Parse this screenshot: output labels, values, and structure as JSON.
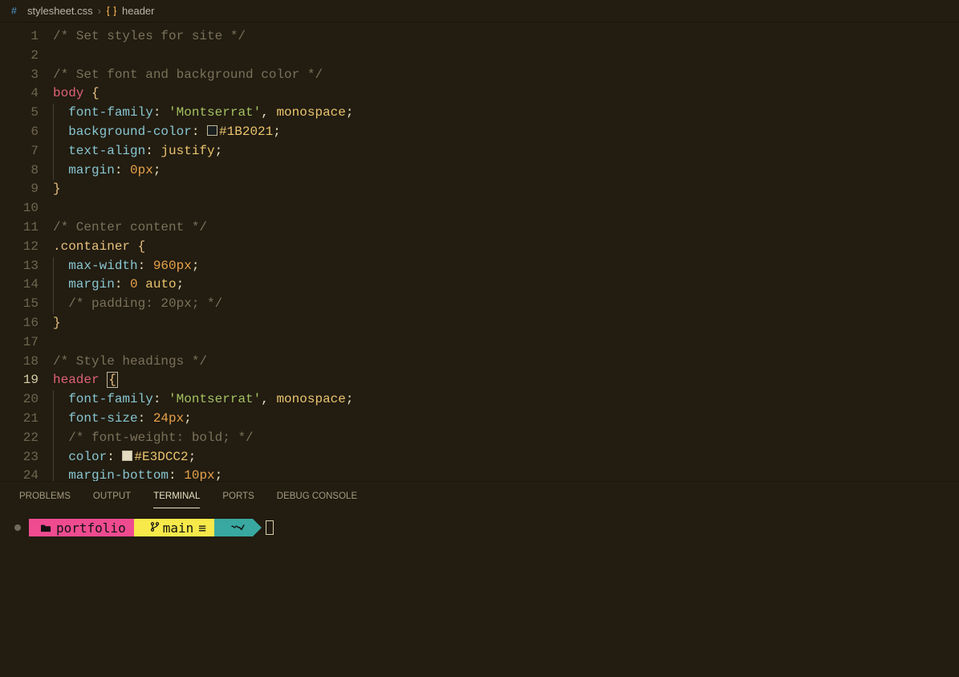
{
  "breadcrumb": {
    "file": "stylesheet.css",
    "symbol": "header"
  },
  "editor": {
    "swatch_colors": {
      "1": "#1B2021",
      "2": "#E3DCC2"
    },
    "lines": [
      {
        "n": 1,
        "tokens": [
          {
            "t": "/* Set styles for site */",
            "c": "cmt"
          }
        ]
      },
      {
        "n": 2,
        "tokens": []
      },
      {
        "n": 3,
        "tokens": [
          {
            "t": "/* Set font and background color */",
            "c": "cmt"
          }
        ]
      },
      {
        "n": 4,
        "tokens": [
          {
            "t": "body",
            "c": "sel"
          },
          {
            "t": " ",
            "c": "punc"
          },
          {
            "t": "{",
            "c": "brace"
          }
        ]
      },
      {
        "n": 5,
        "indent": 1,
        "tokens": [
          {
            "t": "font-family",
            "c": "prop"
          },
          {
            "t": ": ",
            "c": "punc"
          },
          {
            "t": "'Montserrat'",
            "c": "str"
          },
          {
            "t": ", ",
            "c": "punc"
          },
          {
            "t": "monospace",
            "c": "val"
          },
          {
            "t": ";",
            "c": "punc"
          }
        ]
      },
      {
        "n": 6,
        "indent": 1,
        "tokens": [
          {
            "t": "background-color",
            "c": "prop"
          },
          {
            "t": ": ",
            "c": "punc"
          },
          {
            "swatch": "1"
          },
          {
            "t": "#1B2021",
            "c": "val"
          },
          {
            "t": ";",
            "c": "punc"
          }
        ]
      },
      {
        "n": 7,
        "indent": 1,
        "tokens": [
          {
            "t": "text-align",
            "c": "prop"
          },
          {
            "t": ": ",
            "c": "punc"
          },
          {
            "t": "justify",
            "c": "val"
          },
          {
            "t": ";",
            "c": "punc"
          }
        ]
      },
      {
        "n": 8,
        "indent": 1,
        "tokens": [
          {
            "t": "margin",
            "c": "prop"
          },
          {
            "t": ": ",
            "c": "punc"
          },
          {
            "t": "0px",
            "c": "num"
          },
          {
            "t": ";",
            "c": "punc"
          }
        ]
      },
      {
        "n": 9,
        "tokens": [
          {
            "t": "}",
            "c": "brace"
          }
        ]
      },
      {
        "n": 10,
        "tokens": []
      },
      {
        "n": 11,
        "tokens": [
          {
            "t": "/* Center content */",
            "c": "cmt"
          }
        ]
      },
      {
        "n": 12,
        "tokens": [
          {
            "t": ".container",
            "c": "classsel"
          },
          {
            "t": " ",
            "c": "punc"
          },
          {
            "t": "{",
            "c": "brace"
          }
        ]
      },
      {
        "n": 13,
        "indent": 1,
        "tokens": [
          {
            "t": "max-width",
            "c": "prop"
          },
          {
            "t": ": ",
            "c": "punc"
          },
          {
            "t": "960px",
            "c": "num"
          },
          {
            "t": ";",
            "c": "punc"
          }
        ]
      },
      {
        "n": 14,
        "indent": 1,
        "tokens": [
          {
            "t": "margin",
            "c": "prop"
          },
          {
            "t": ": ",
            "c": "punc"
          },
          {
            "t": "0",
            "c": "num"
          },
          {
            "t": " ",
            "c": "punc"
          },
          {
            "t": "auto",
            "c": "val"
          },
          {
            "t": ";",
            "c": "punc"
          }
        ]
      },
      {
        "n": 15,
        "indent": 1,
        "tokens": [
          {
            "t": "/* padding: 20px; */",
            "c": "cmt"
          }
        ]
      },
      {
        "n": 16,
        "tokens": [
          {
            "t": "}",
            "c": "brace"
          }
        ]
      },
      {
        "n": 17,
        "tokens": []
      },
      {
        "n": 18,
        "tokens": [
          {
            "t": "/* Style headings */",
            "c": "cmt"
          }
        ]
      },
      {
        "n": 19,
        "active": true,
        "tokens": [
          {
            "t": "header",
            "c": "sel"
          },
          {
            "t": " ",
            "c": "punc"
          },
          {
            "t": "{",
            "c": "brace",
            "cursor": true
          }
        ]
      },
      {
        "n": 20,
        "indent": 1,
        "tokens": [
          {
            "t": "font-family",
            "c": "prop"
          },
          {
            "t": ": ",
            "c": "punc"
          },
          {
            "t": "'Montserrat'",
            "c": "str"
          },
          {
            "t": ", ",
            "c": "punc"
          },
          {
            "t": "monospace",
            "c": "val"
          },
          {
            "t": ";",
            "c": "punc"
          }
        ]
      },
      {
        "n": 21,
        "indent": 1,
        "tokens": [
          {
            "t": "font-size",
            "c": "prop"
          },
          {
            "t": ": ",
            "c": "punc"
          },
          {
            "t": "24px",
            "c": "num"
          },
          {
            "t": ";",
            "c": "punc"
          }
        ]
      },
      {
        "n": 22,
        "indent": 1,
        "tokens": [
          {
            "t": "/* font-weight: bold; */",
            "c": "cmt"
          }
        ]
      },
      {
        "n": 23,
        "indent": 1,
        "tokens": [
          {
            "t": "color",
            "c": "prop"
          },
          {
            "t": ": ",
            "c": "punc"
          },
          {
            "swatch": "2"
          },
          {
            "t": "#E3DCC2",
            "c": "val"
          },
          {
            "t": ";",
            "c": "punc"
          }
        ]
      },
      {
        "n": 24,
        "indent": 1,
        "tokens": [
          {
            "t": "margin-bottom",
            "c": "prop"
          },
          {
            "t": ": ",
            "c": "punc"
          },
          {
            "t": "10px",
            "c": "num"
          },
          {
            "t": ";",
            "c": "punc"
          }
        ]
      }
    ]
  },
  "panel": {
    "tabs": [
      "PROBLEMS",
      "OUTPUT",
      "TERMINAL",
      "PORTS",
      "DEBUG CONSOLE"
    ],
    "active_tab": 2,
    "prompt": {
      "folder": "portfolio",
      "branch": "main",
      "branch_sync": "≡"
    }
  }
}
